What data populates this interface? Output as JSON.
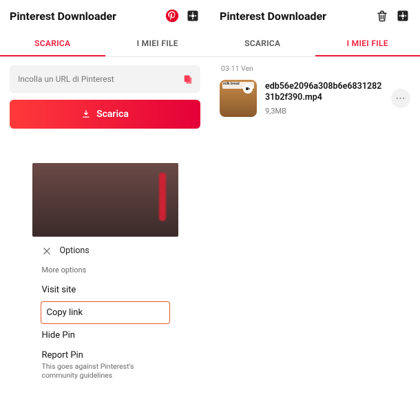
{
  "left": {
    "title": "Pinterest Downloader",
    "tabs": {
      "download": "SCARICA",
      "files": "I MIEI FILE",
      "active": "download"
    },
    "url_placeholder": "Incolla un URL di Pinterest",
    "download_btn": "Scarica",
    "options": {
      "header": "Options",
      "more": "More options",
      "items": {
        "visit": "Visit site",
        "copy": "Copy link",
        "hide": "Hide Pin",
        "report": "Report Pin",
        "report_sub": "This goes against Pinterest's community guidelines"
      }
    }
  },
  "right": {
    "title": "Pinterest Downloader",
    "tabs": {
      "download": "SCARICA",
      "files": "I MIEI FILE",
      "active": "files"
    },
    "date_label": "03-11 Ven",
    "file": {
      "name": "edb56e2096a308b6e683128231b2f390.mp4",
      "size": "9,3MB",
      "thumb_caption": "milk bread"
    }
  }
}
